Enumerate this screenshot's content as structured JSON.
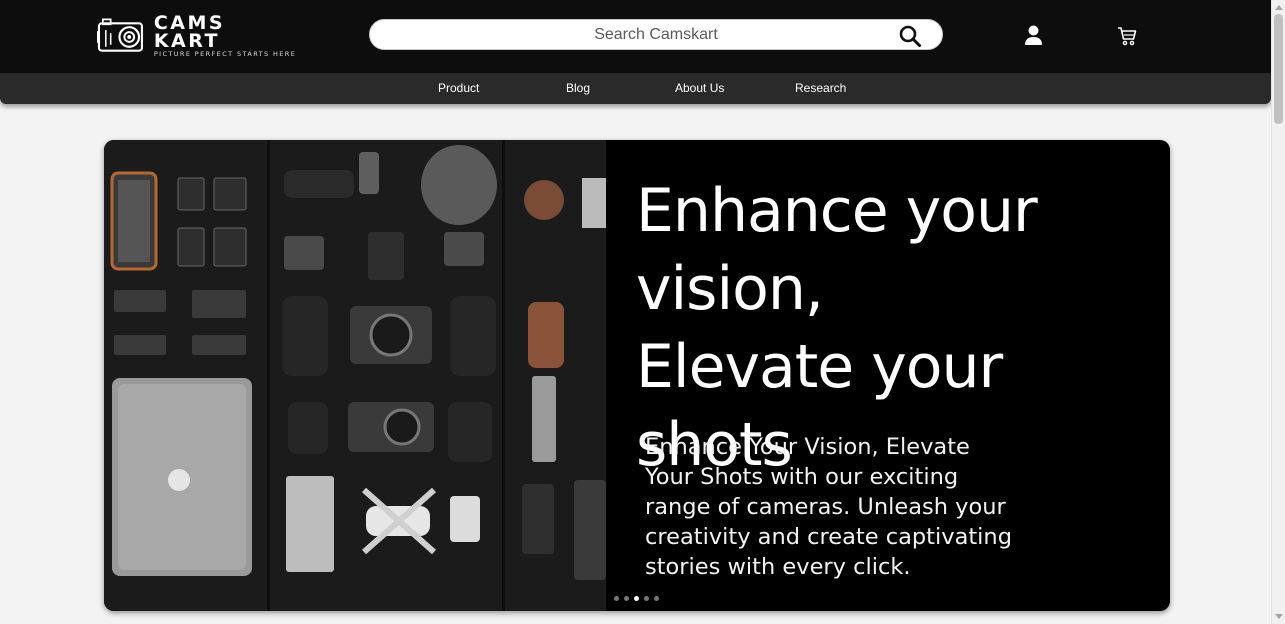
{
  "header": {
    "logo": {
      "name": "CAMS KART",
      "tagline": "PICTURE PERFECT STARTS HERE"
    },
    "search": {
      "placeholder": "Search Camskart",
      "icon": "search-icon"
    },
    "icons": {
      "user": "user-icon",
      "cart": "cart-icon"
    }
  },
  "nav": {
    "items": [
      {
        "label": "Product"
      },
      {
        "label": "Blog"
      },
      {
        "label": "About Us"
      },
      {
        "label": "Research"
      }
    ]
  },
  "hero": {
    "headline": "Enhance your\nvision,\nElevate your  shots",
    "body": "Enhance Your Vision, Elevate Your Shots with our exciting range of cameras. Unleash your creativity and create captivating stories with every click.",
    "slides": {
      "count": 5,
      "active_index": 2
    }
  },
  "colors": {
    "header_bg": "#0d0d0d",
    "nav_bg": "#2a2a2a",
    "page_bg": "#f3f3f3",
    "hero_bg": "#000000",
    "text_light": "#ffffff"
  }
}
